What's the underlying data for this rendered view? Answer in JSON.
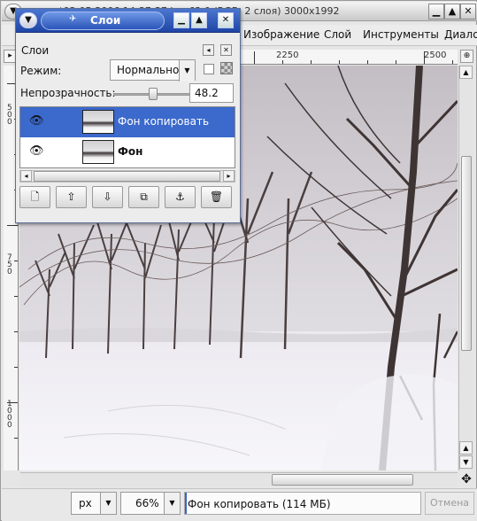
{
  "window": {
    "title": "*03-05-2006 14-37-37.jpg-62.0 (RGB, 2 слоя) 3000x1992"
  },
  "menu": {
    "items": [
      "Изображение",
      "Слой",
      "Инструменты",
      "Диало"
    ]
  },
  "ruler": {
    "h_labels": [
      "2250",
      "2500"
    ],
    "v_labels": [
      "500",
      "750",
      "1000"
    ]
  },
  "status": {
    "unit": "px",
    "zoom": "66%",
    "message": "Фон копировать (114 МБ)",
    "cancel_label": "Отмена"
  },
  "layers_dialog": {
    "title": "Слои",
    "header": "Слои",
    "mode_label": "Режим:",
    "mode_value": "Нормально",
    "opacity_label": "Непрозрачность:",
    "opacity_value": "48.2",
    "opacity_fraction": 0.482,
    "layers": [
      {
        "name": "Фон копировать",
        "visible": true,
        "selected": true
      },
      {
        "name": "Фон",
        "visible": true,
        "selected": false
      }
    ],
    "buttons": [
      "new-layer-icon",
      "raise-layer-icon",
      "lower-layer-icon",
      "duplicate-layer-icon",
      "anchor-layer-icon",
      "delete-layer-icon"
    ]
  },
  "colors": {
    "selection": "#3b69cc",
    "titlebar_active": "#2c55b5"
  }
}
